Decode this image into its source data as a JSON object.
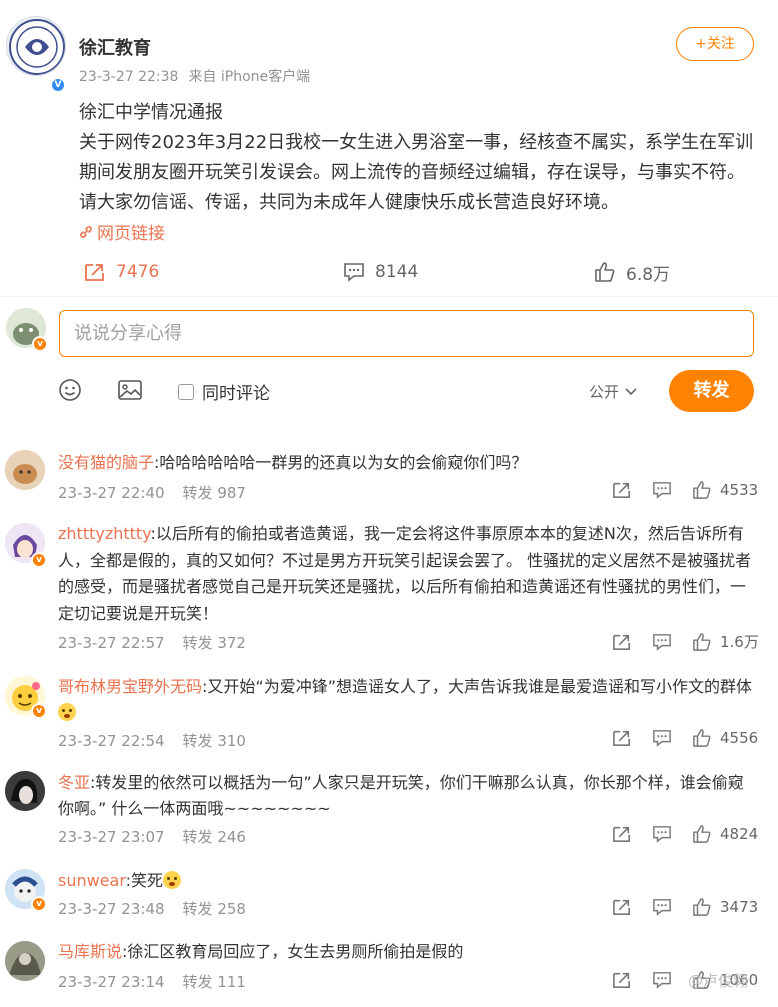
{
  "post": {
    "author": "徐汇教育",
    "time": "23-3-27 22:38",
    "source": "来自 iPhone客户端",
    "follow_label": "+关注",
    "text": "徐汇中学情况通报\n关于网传2023年3月22日我校一女生进入男浴室一事，经核查不属实，系学生在军训期间发朋友圈开玩笑引发误会。网上流传的音频经过编辑，存在误导，与事实不符。请大家勿信谣、传谣，共同为未成年人健康快乐成长营造良好环境。",
    "link_label": "网页链接",
    "reposts": "7476",
    "comments": "8144",
    "likes": "6.8万"
  },
  "composer": {
    "placeholder": "说说分享心得",
    "sync_label": "同时评论",
    "visibility": "公开",
    "submit_label": "转发"
  },
  "comments": [
    {
      "user": "没有猫的脑子",
      "text": ":哈哈哈哈哈哈一群男的还真以为女的会偷窥你们吗？",
      "time": "23-3-27 22:40",
      "repost": "转发 987",
      "likes": "4533"
    },
    {
      "user": "zhtttyzhttty",
      "text": ":以后所有的偷拍或者造黄谣，我一定会将这件事原原本本的复述N次，然后告诉所有人，全都是假的，真的又如何？不过是男方开玩笑引起误会罢了。 性骚扰的定义居然不是被骚扰者的感受，而是骚扰者感觉自己是开玩笑还是骚扰，以后所有偷拍和造黄谣还有性骚扰的男性们，一定切记要说是开玩笑！",
      "time": "23-3-27 22:57",
      "repost": "转发 372",
      "likes": "1.6万"
    },
    {
      "user": "哥布林男宝野外无码",
      "text": ":又开始“为爱冲锋”想造谣女人了，大声告诉我谁是最爱造谣和写小作文的群体",
      "time": "23-3-27 22:54",
      "repost": "转发 310",
      "likes": "4556"
    },
    {
      "user": "冬亚",
      "text": ":转发里的依然可以概括为一句”人家只是开玩笑，你们干嘛那么认真，你长那个样，谁会偷窥你啊。” 什么一体两面哦~~~~~~~~",
      "time": "23-3-27 23:07",
      "repost": "转发 246",
      "likes": "4824"
    },
    {
      "user": "sunwear",
      "text": ":笑死",
      "time": "23-3-27 23:48",
      "repost": "转发 258",
      "likes": "3473"
    },
    {
      "user": "马库斯说",
      "text": ":徐汇区教育局回应了，女生去男厕所偷拍是假的",
      "time": "23-3-27 23:14",
      "repost": "转发 111",
      "likes": "1060"
    }
  ],
  "watermark": "@卢俊翱",
  "colors": {
    "accent": "#ff8200",
    "user_name": "#eb7350",
    "meta": "#939393"
  }
}
